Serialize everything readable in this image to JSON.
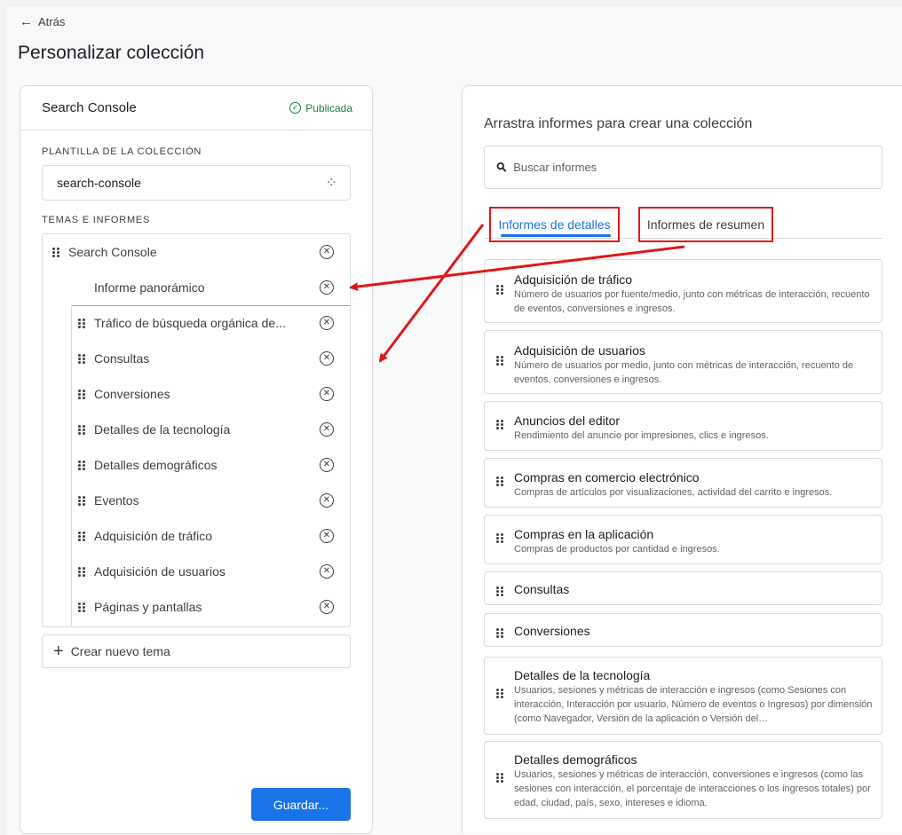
{
  "nav": {
    "back_label": "Atrás"
  },
  "page_title": "Personalizar colección",
  "left": {
    "name": "Search Console",
    "status": "Publicada",
    "template_label": "PLANTILLA DE LA COLECCIÓN",
    "template_value": "search-console",
    "topics_label": "TEMAS E INFORMES",
    "topic_title": "Search Console",
    "overview": "Informe panorámico",
    "reports": [
      "Tráfico de búsqueda orgánica de...",
      "Consultas",
      "Conversiones",
      "Detalles de la tecnología",
      "Detalles demográficos",
      "Eventos",
      "Adquisición de tráfico",
      "Adquisición de usuarios",
      "Páginas y pantallas"
    ],
    "new_topic": "Crear nuevo tema",
    "save": "Guardar..."
  },
  "right": {
    "title": "Arrastra informes para crear una colección",
    "search_placeholder": "Buscar informes",
    "tabs": [
      "Informes de detalles",
      "Informes de resumen"
    ],
    "cards": [
      {
        "title": "Adquisición de tráfico",
        "desc": "Número de usuarios por fuente/medio, junto con métricas de interacción, recuento de eventos, conversiones e ingresos."
      },
      {
        "title": "Adquisición de usuarios",
        "desc": "Número de usuarios por medio, junto con métricas de interacción, recuento de eventos, conversiones e ingresos."
      },
      {
        "title": "Anuncios del editor",
        "desc": "Rendimiento del anuncio por impresiones, clics e ingresos."
      },
      {
        "title": "Compras en comercio electrónico",
        "desc": "Compras de artículos por visualizaciones, actividad del carrito e ingresos."
      },
      {
        "title": "Compras en la aplicación",
        "desc": "Compras de productos por cantidad e ingresos."
      },
      {
        "title": "Consultas",
        "desc": ""
      },
      {
        "title": "Conversiones",
        "desc": ""
      },
      {
        "title": "Detalles de la tecnología",
        "desc": "Usuarios, sesiones y métricas de interacción e ingresos (como Sesiones con interacción, Interacción por usuario, Número de eventos o Ingresos) por dimensión (como Navegador, Versión de la aplicación o Versión del…"
      },
      {
        "title": "Detalles demográficos",
        "desc": "Usuarios, sesiones y métricas de interacción, conversiones e ingresos (como las sesiones con interacción, el porcentaje de interacciones o los ingresos totales) por edad, ciudad, país, sexo, intereses e idioma."
      }
    ]
  },
  "colors": {
    "accent": "#1a73e8",
    "published": "#188038",
    "annotation": "#e01818"
  }
}
